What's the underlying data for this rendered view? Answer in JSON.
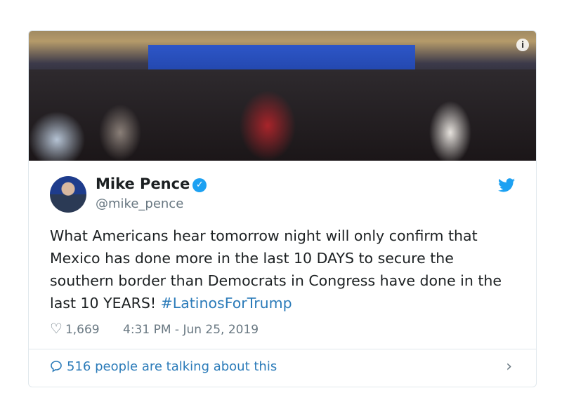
{
  "tweet": {
    "author_name": "Mike Pence",
    "handle": "@mike_pence",
    "text": "What Americans hear tomorrow night will only confirm that Mexico has done more in the last 10 DAYS to secure the southern border than Democrats in Congress have done in the last 10 YEARS! ",
    "hashtag": "#LatinosForTrump",
    "likes": "1,669",
    "timestamp": "4:31 PM - Jun 25, 2019",
    "talking": "516 people are talking about this"
  },
  "icons": {
    "info": "i",
    "verified": "✓",
    "heart": "♡",
    "comment": "💬",
    "chevron": "›",
    "bird": "twitter-bird"
  },
  "colors": {
    "accent": "#1da1f2",
    "link": "#2b7bb9"
  }
}
